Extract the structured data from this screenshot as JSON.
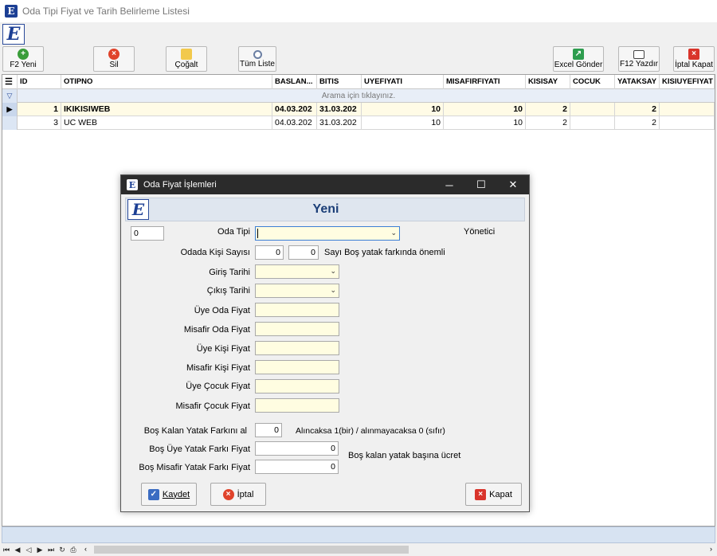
{
  "window": {
    "title": "Oda Tipi Fiyat ve Tarih Belirleme Listesi",
    "app_letter": "E"
  },
  "toolbar": {
    "new_label": "F2 Yeni",
    "delete_label": "Sil",
    "copy_label": "Çoğalt",
    "list_all_label": "Tüm Liste",
    "excel_label": "Excel Gönder",
    "print_label": "F12 Yazdır",
    "cancel_label": "İptal Kapat"
  },
  "grid": {
    "columns": [
      "ID",
      "OTIPNO",
      "BASLAN...",
      "BITIS",
      "UYEFIYATI",
      "MISAFIRFIYATI",
      "KISISAY",
      "COCUK",
      "YATAKSAY",
      "KISIUYEFIYAT"
    ],
    "search_hint": "Arama için tıklayınız.",
    "rows": [
      {
        "id": "1",
        "otipno": "IKIKISIWEB",
        "baslangic": "04.03.202",
        "bitis": "31.03.202",
        "uyefiyati": "10",
        "misafirfiyati": "10",
        "kisisay": "2",
        "cocuk": "",
        "yataksay": "2",
        "kisiuyefiyat": ""
      },
      {
        "id": "3",
        "otipno": "UC WEB",
        "baslangic": "04.03.202",
        "bitis": "31.03.202",
        "uyefiyati": "10",
        "misafirfiyati": "10",
        "kisisay": "2",
        "cocuk": "",
        "yataksay": "2",
        "kisiuyefiyat": ""
      }
    ]
  },
  "dialog": {
    "title": "Oda Fiyat İşlemleri",
    "heading": "Yeni",
    "id_value": "0",
    "role_label": "Yönetici",
    "room_type_label": "Oda Tipi",
    "room_type_value": "",
    "person_count_label": "Odada Kişi Sayısı",
    "person_count_value": "0",
    "empty_bed_count_value": "0",
    "empty_bed_note": "Sayı Boş yatak farkında önemli",
    "checkin_label": "Giriş Tarihi",
    "checkout_label": "Çıkış Tarihi",
    "member_room_price_label": "Üye Oda Fiyat",
    "guest_room_price_label": "Misafir Oda Fiyat",
    "member_person_price_label": "Üye Kişi Fiyat",
    "guest_person_price_label": "Misafir Kişi Fiyat",
    "member_child_price_label": "Üye Çocuk Fiyat",
    "guest_child_price_label": "Misafir Çocuk Fiyat",
    "empty_bed_diff_label": "Boş Kalan Yatak Farkını al",
    "empty_bed_diff_value": "0",
    "empty_bed_diff_note": "Alıncaksa 1(bir) / alınmayacaksa 0 (sıfır)",
    "member_bed_diff_label": "Boş Üye Yatak Farkı Fiyat",
    "member_bed_diff_value": "0",
    "guest_bed_diff_label": "Boş Misafir Yatak Farkı Fiyat",
    "guest_bed_diff_value": "0",
    "per_bed_note": "Boş kalan yatak başına ücret",
    "save_label": "Kaydet",
    "cancel_label": "İptal",
    "close_label": "Kapat"
  },
  "icons": {
    "new": "plus-circle-icon",
    "delete": "x-circle-icon",
    "copy": "folders-icon",
    "search": "magnifier-icon",
    "excel": "excel-arrow-icon",
    "print": "printer-icon",
    "close": "red-x-icon",
    "save": "checkmark-icon"
  },
  "colors": {
    "accent": "#1c3f94",
    "field_bg": "#fffde1",
    "title_bar_dark": "#2b2b2b",
    "grid_selected": "#fffbe6",
    "danger": "#d9342b",
    "ok": "#3a9d3a"
  }
}
